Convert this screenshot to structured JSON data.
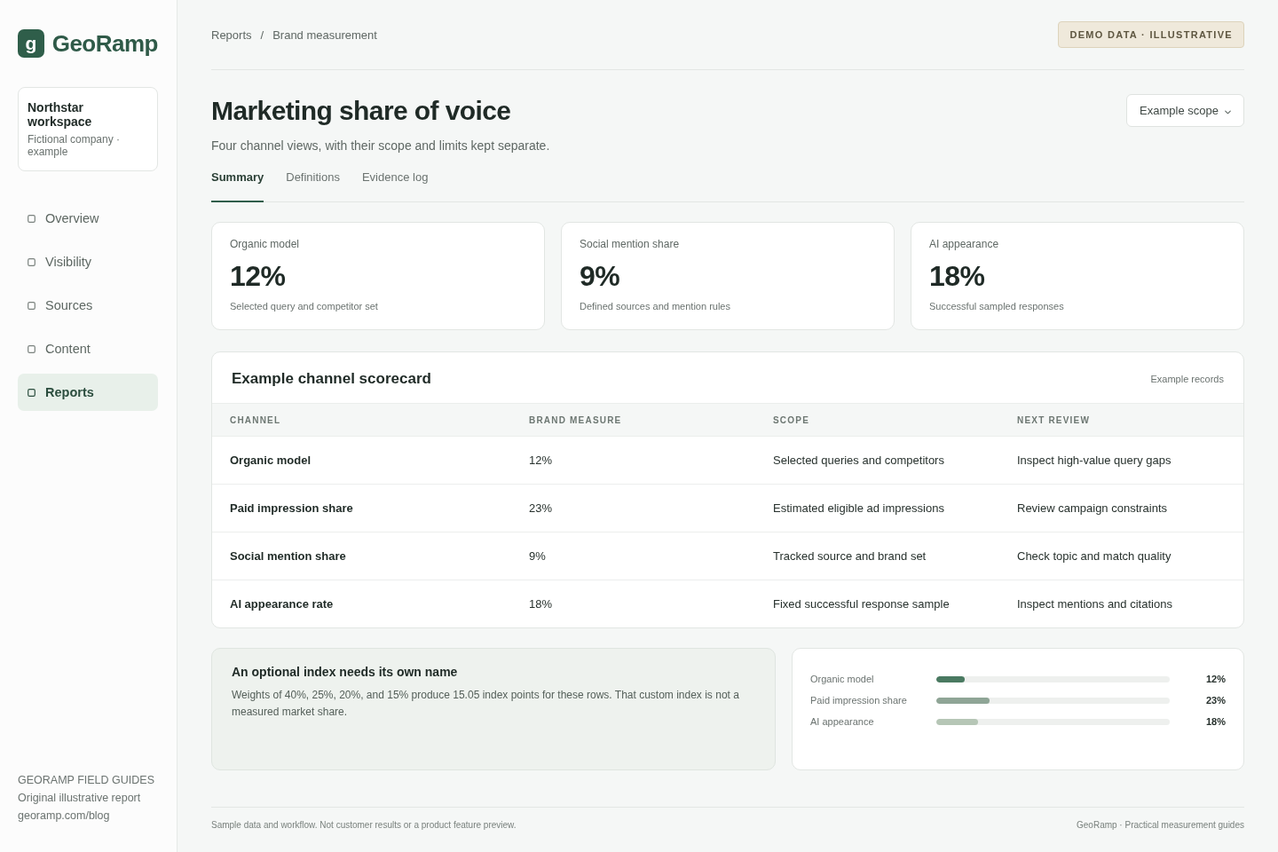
{
  "sidebar": {
    "logo": {
      "mark": "g",
      "name": "GeoRamp"
    },
    "workspace": {
      "name": "Northstar workspace",
      "description": "Fictional company · example"
    },
    "nav": [
      {
        "label": "Overview",
        "selected": false
      },
      {
        "label": "Visibility",
        "selected": false
      },
      {
        "label": "Sources",
        "selected": false
      },
      {
        "label": "Content",
        "selected": false
      },
      {
        "label": "Reports",
        "selected": true
      }
    ],
    "guides": {
      "heading": "GEORAMP FIELD GUIDES",
      "subtitle": "Original illustrative report",
      "link": "georamp.com/blog"
    }
  },
  "breadcrumb": {
    "items": [
      "Reports",
      "Brand measurement"
    ],
    "separator": "/"
  },
  "badge": "DEMO DATA · ILLUSTRATIVE",
  "page": {
    "title": "Marketing share of voice",
    "subtitle": "Four channel views, with their scope and limits kept separate."
  },
  "scope_select": {
    "value": "Example scope"
  },
  "tabs": [
    {
      "label": "Summary",
      "selected": true
    },
    {
      "label": "Definitions",
      "selected": false
    },
    {
      "label": "Evidence log",
      "selected": false
    }
  ],
  "kpis": [
    {
      "label": "Organic model",
      "value": "12%",
      "note": "Selected query and competitor set"
    },
    {
      "label": "Social mention share",
      "value": "9%",
      "note": "Defined sources and mention rules"
    },
    {
      "label": "AI appearance",
      "value": "18%",
      "note": "Successful sampled responses"
    }
  ],
  "scorecard": {
    "title": "Example channel scorecard",
    "note": "Example records",
    "columns": [
      "CHANNEL",
      "BRAND MEASURE",
      "SCOPE",
      "NEXT REVIEW"
    ],
    "rows": [
      [
        "Organic model",
        "12%",
        "Selected queries and competitors",
        "Inspect high-value query gaps"
      ],
      [
        "Paid impression share",
        "23%",
        "Estimated eligible ad impressions",
        "Review campaign constraints"
      ],
      [
        "Social mention share",
        "9%",
        "Tracked source and brand set",
        "Check topic and match quality"
      ],
      [
        "AI appearance rate",
        "18%",
        "Fixed successful response sample",
        "Inspect mentions and citations"
      ]
    ]
  },
  "index_note": {
    "title": "An optional index needs its own name",
    "text": "Weights of 40%, 25%, 20%, and 15% produce 15.05 index points for these rows. That custom index is not a measured market share."
  },
  "index_bars": [
    {
      "label": "Organic model",
      "level": 0.12,
      "reading": "12%",
      "color": "#4a7a61"
    },
    {
      "label": "Paid impression share",
      "level": 0.23,
      "reading": "23%",
      "color": "#8fa596"
    },
    {
      "label": "AI appearance",
      "level": 0.18,
      "reading": "18%",
      "color": "#b6c6b6"
    }
  ],
  "footer": {
    "disclaimer": "Sample data and workflow. Not customer results or a product feature preview.",
    "credit": "GeoRamp · Practical measurement guides"
  }
}
